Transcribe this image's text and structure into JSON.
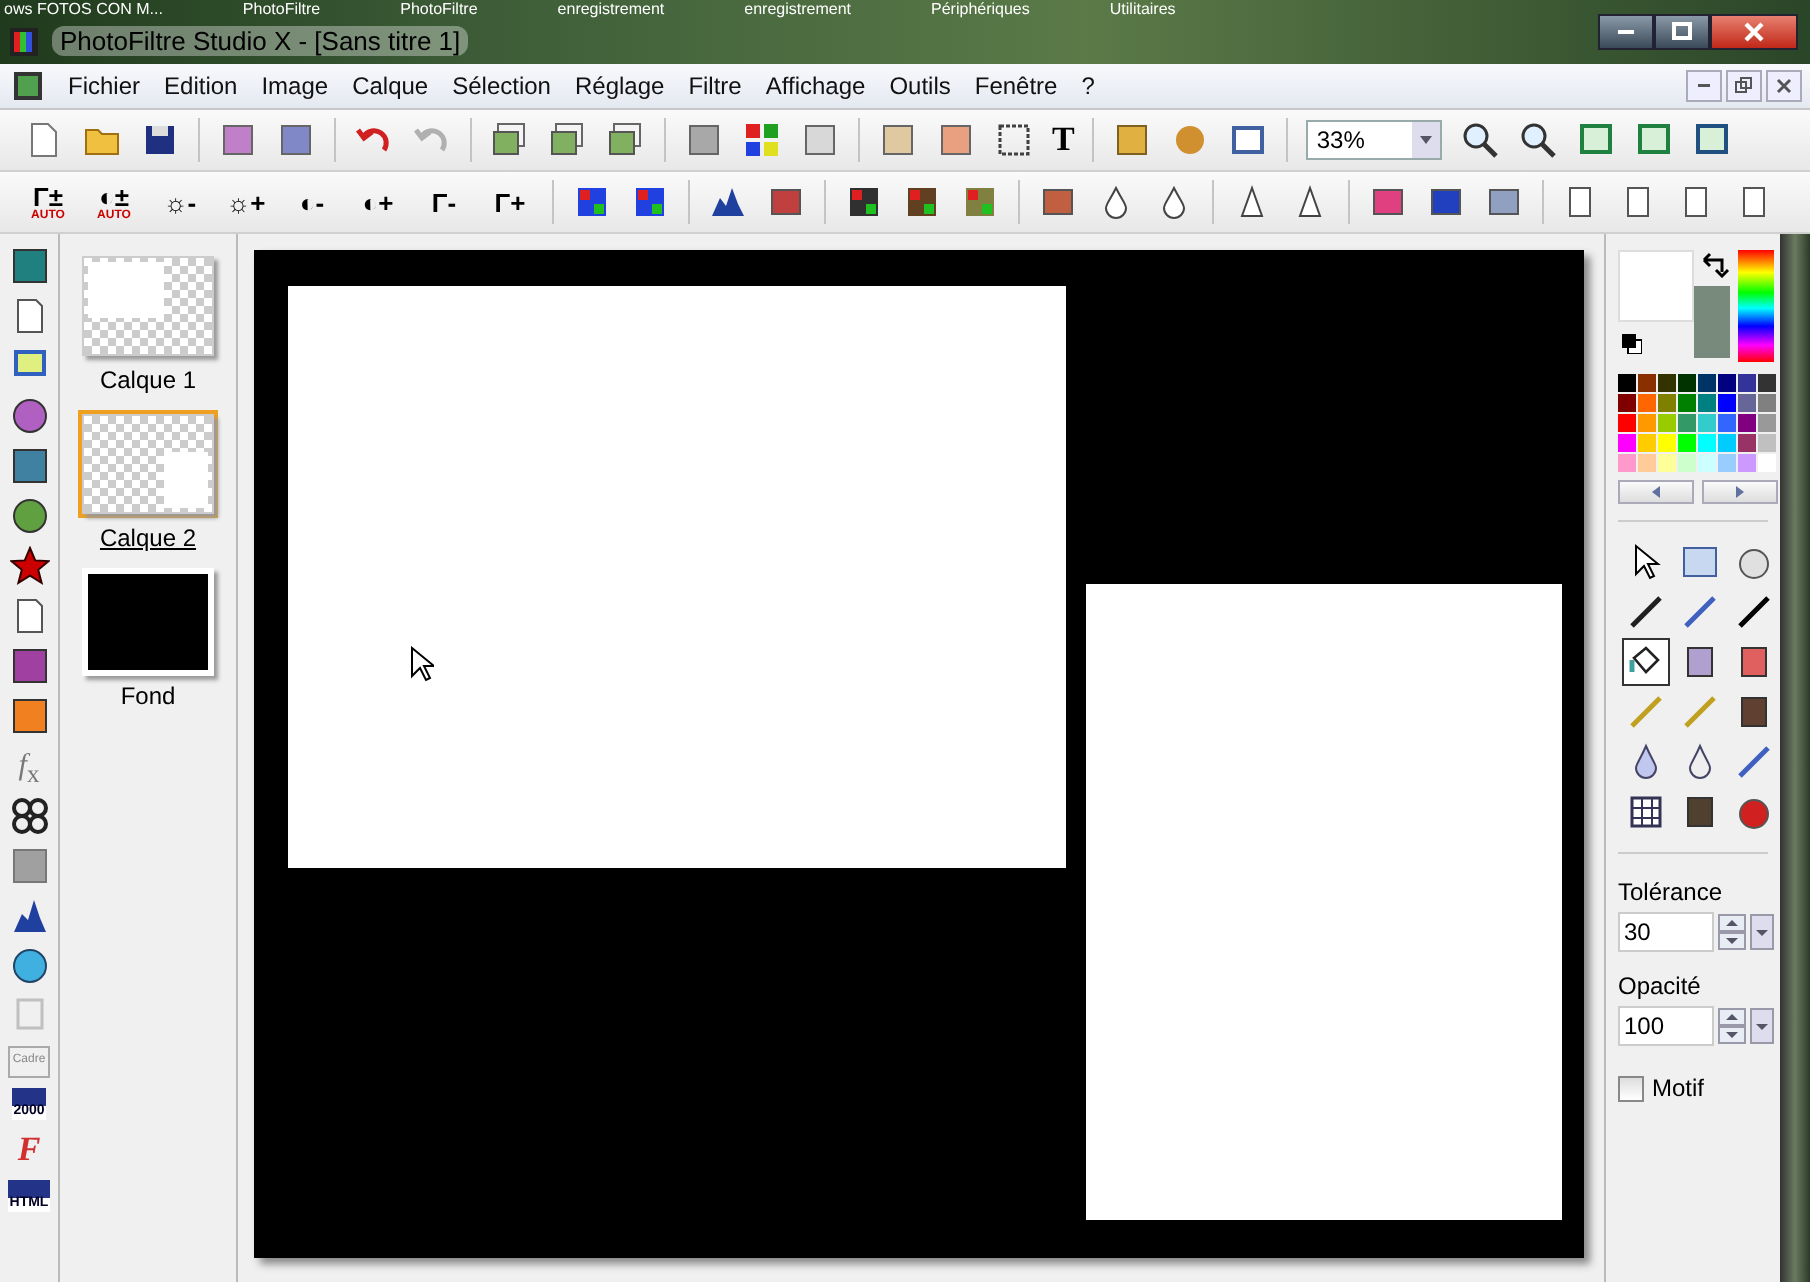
{
  "taskbar": [
    "ows FOTOS CON M...",
    "PhotoFiltre",
    "PhotoFiltre",
    "enregistrement",
    "enregistrement",
    "Périphériques",
    "Utilitaires"
  ],
  "window": {
    "title": "PhotoFiltre Studio X - [Sans titre 1]"
  },
  "menu": [
    "Fichier",
    "Edition",
    "Image",
    "Calque",
    "Sélection",
    "Réglage",
    "Filtre",
    "Affichage",
    "Outils",
    "Fenêtre",
    "?"
  ],
  "toolbar_1": {
    "text_tool": "T",
    "zoom": "33%"
  },
  "toolbar_2_glyphs": [
    {
      "glyph": "Γ±",
      "sub": "AUTO"
    },
    {
      "glyph": "◐±",
      "sub": "AUTO"
    },
    {
      "glyph": "☼-"
    },
    {
      "glyph": "☼+"
    },
    {
      "glyph": "◐-"
    },
    {
      "glyph": "◐+"
    },
    {
      "glyph": "Γ-"
    },
    {
      "glyph": "Γ+"
    }
  ],
  "left_toolbar_glyphs": {
    "fx": "*f*$_{x}$",
    "save_2000": "2000",
    "cadre": "Cadre",
    "font": "F",
    "save_html": "HTML"
  },
  "layers": [
    {
      "name": "Calque 1",
      "kind": "white-left",
      "selected": false
    },
    {
      "name": "Calque 2",
      "kind": "white-right",
      "selected": true
    },
    {
      "name": "Fond",
      "kind": "black",
      "selected": false
    }
  ],
  "tools": [
    {
      "selected": false
    },
    {
      "selected": false
    },
    {
      "selected": false
    },
    {
      "selected": false
    },
    {
      "selected": false
    },
    {
      "selected": false
    },
    {
      "selected": true
    },
    {
      "selected": false
    },
    {
      "selected": false
    },
    {
      "selected": false
    },
    {
      "selected": false
    },
    {
      "selected": false
    },
    {
      "selected": false
    },
    {
      "selected": false
    },
    {
      "selected": false
    },
    {
      "selected": false
    },
    {
      "selected": false
    },
    {
      "selected": false
    }
  ],
  "tolerance": {
    "label": "Tolérance",
    "value": "30"
  },
  "opacity": {
    "label": "Opacité",
    "value": "100"
  },
  "pattern": {
    "label": "Motif",
    "checked": false
  }
}
